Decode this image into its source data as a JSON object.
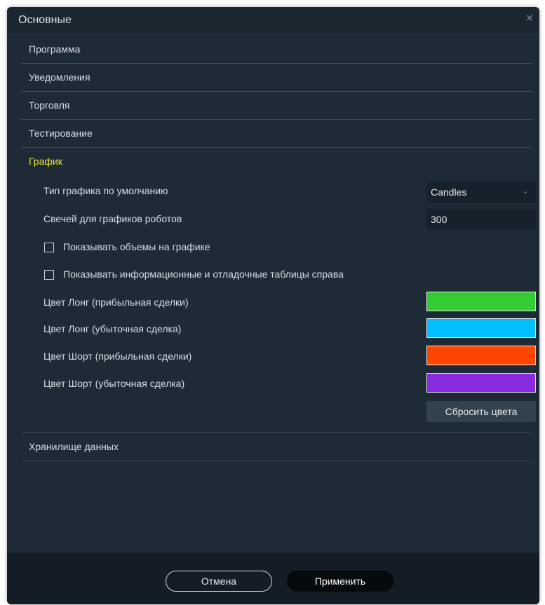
{
  "dialog": {
    "title": "Основные",
    "close_glyph": "✕"
  },
  "sections": [
    {
      "label": "Программа",
      "active": false
    },
    {
      "label": "Уведомления",
      "active": false
    },
    {
      "label": "Торговля",
      "active": false
    },
    {
      "label": "Тестирование",
      "active": false
    },
    {
      "label": "График",
      "active": true
    },
    {
      "label": "Хранилище данных",
      "active": false
    }
  ],
  "chart_settings": {
    "chart_type_label": "Тип графика по умолчанию",
    "chart_type_value": "Candles",
    "candles_label": "Свечей для графиков роботов",
    "candles_value": "300",
    "show_volumes_label": "Показывать объемы на графике",
    "show_volumes_checked": false,
    "show_tables_label": "Показывать информационные и отладочные таблицы справа",
    "show_tables_checked": false,
    "colors": [
      {
        "label": "Цвет Лонг (прибыльная сделки)",
        "color": "#33cc33"
      },
      {
        "label": "Цвет Лонг (убыточная сделка)",
        "color": "#00bfff"
      },
      {
        "label": "Цвет Шорт (прибыльная сделки)",
        "color": "#ff4500"
      },
      {
        "label": "Цвет Шорт (убыточная сделка)",
        "color": "#8a2be2"
      }
    ],
    "reset_colors_label": "Сбросить цвета"
  },
  "footer": {
    "cancel_label": "Отмена",
    "apply_label": "Применить"
  }
}
